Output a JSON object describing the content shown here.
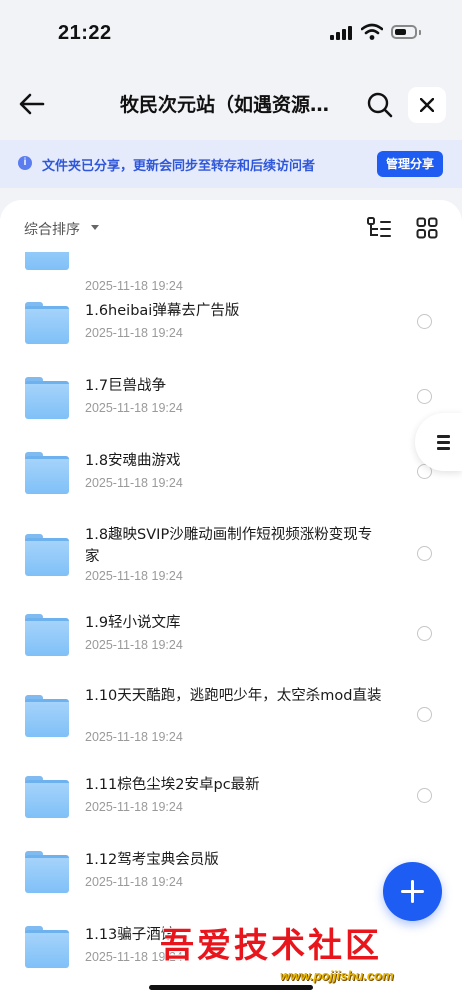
{
  "status_bar": {
    "time": "21:22"
  },
  "nav": {
    "title": "牧民次元站（如遇资源…"
  },
  "banner": {
    "info_icon": "i",
    "text": "文件夹已分享，更新会同步至转存和后续访问者",
    "manage_label": "管理分享"
  },
  "toolbar": {
    "sort_label": "综合排序"
  },
  "files": [
    {
      "name": "",
      "date": "2025-11-18 19:24"
    },
    {
      "name": "1.6heibai弹幕去广告版",
      "date": "2025-11-18 19:24"
    },
    {
      "name": "1.7巨兽战争",
      "date": "2025-11-18 19:24"
    },
    {
      "name": "1.8安魂曲游戏",
      "date": "2025-11-18 19:24"
    },
    {
      "name": "1.8趣映SVIP沙雕动画制作短视频涨粉变现专家",
      "date": "2025-11-18 19:24"
    },
    {
      "name": "1.9轻小说文库",
      "date": "2025-11-18 19:24"
    },
    {
      "name": "1.10天天酷跑，逃跑吧少年，太空杀mod直装",
      "date": "2025-11-18 19:24"
    },
    {
      "name": "1.11棕色尘埃2安卓pc最新",
      "date": "2025-11-18 19:24"
    },
    {
      "name": "1.12驾考宝典会员版",
      "date": "2025-11-18 19:24"
    },
    {
      "name": "1.13骗子酒馆",
      "date": "2025-11-18 19:24"
    }
  ],
  "watermark": {
    "text": "吾爱技术社区",
    "url": "www.pojjishu.com"
  },
  "colors": {
    "accent": "#1f5cf2",
    "banner_bg": "#e6ebfb",
    "watermark": "#e8161c"
  },
  "icons": {
    "back": "back-arrow-icon",
    "search": "search-icon",
    "close": "close-icon",
    "tree": "tree-view-icon",
    "grid": "grid-view-icon",
    "folder": "folder-icon",
    "fab": "plus-icon",
    "side": "menu-icon"
  }
}
